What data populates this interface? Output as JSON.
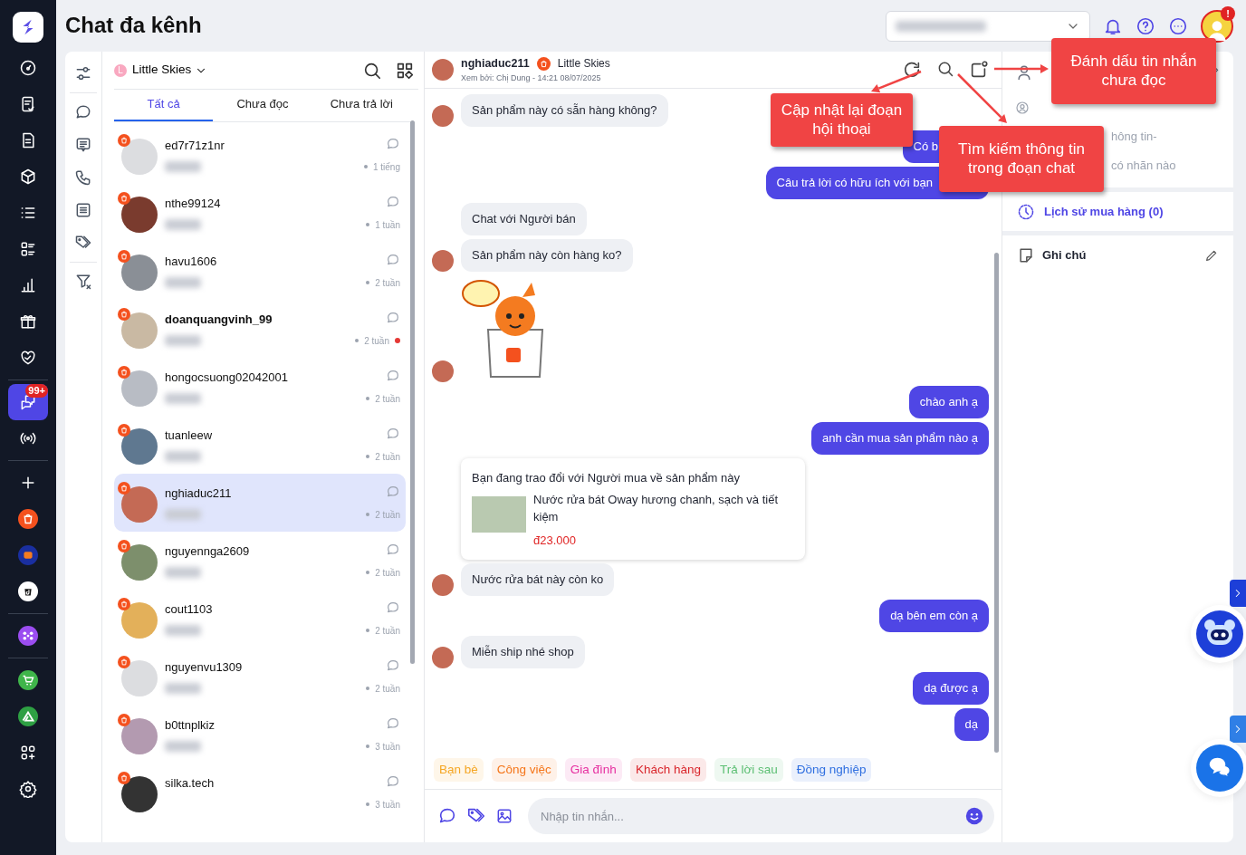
{
  "header": {
    "title": "Chat đa kênh",
    "alert_badge": "!"
  },
  "sidebar": {
    "nav_items": [
      {
        "selected": false
      },
      {
        "selected": false
      },
      {
        "selected": false
      },
      {
        "selected": false
      },
      {
        "selected": false
      },
      {
        "selected": false
      },
      {
        "selected": false
      },
      {
        "selected": false
      },
      {
        "selected": false
      },
      {
        "selected": true,
        "badge": "99+"
      },
      {
        "selected": false
      },
      {
        "selected": false
      },
      {
        "selected": false
      },
      {
        "selected": false
      },
      {
        "selected": false
      },
      {
        "selected": false
      },
      {
        "selected": false
      },
      {
        "selected": false
      },
      {
        "selected": false
      },
      {
        "selected": false
      }
    ]
  },
  "conversation_list": {
    "shop": {
      "initial": "L",
      "name": "Little Skies"
    },
    "tabs": [
      {
        "label": "Tất cả",
        "selected": true
      },
      {
        "label": "Chưa đọc",
        "selected": false
      },
      {
        "label": "Chưa trả lời",
        "selected": false
      }
    ],
    "conversations": [
      {
        "name": "ed7r71z1nr",
        "time": "1 tiếng",
        "unread": false,
        "selected": false,
        "preview_blurred": true
      },
      {
        "name": "nthe99124",
        "time": "1 tuần",
        "unread": false,
        "selected": false,
        "preview_blurred": true
      },
      {
        "name": "havu1606",
        "time": "2 tuần",
        "unread": false,
        "selected": false,
        "preview_blurred": true
      },
      {
        "name": "doanquangvinh_99",
        "time": "2 tuần",
        "unread": true,
        "selected": false,
        "preview_blurred": true
      },
      {
        "name": "hongocsuong02042001",
        "time": "2 tuần",
        "unread": false,
        "selected": false,
        "preview_blurred": true
      },
      {
        "name": "tuanleew",
        "time": "2 tuần",
        "unread": false,
        "selected": false,
        "preview_blurred": true
      },
      {
        "name": "nghiaduc211",
        "time": "2 tuần",
        "unread": false,
        "selected": true,
        "preview_blurred": true
      },
      {
        "name": "nguyennga2609",
        "time": "2 tuần",
        "unread": false,
        "selected": false,
        "preview_blurred": true
      },
      {
        "name": "cout1103",
        "time": "2 tuần",
        "unread": false,
        "selected": false,
        "preview_blurred": true
      },
      {
        "name": "nguyenvu1309",
        "time": "2 tuần",
        "unread": false,
        "selected": false,
        "preview_blurred": true
      },
      {
        "name": "b0ttnplkiz",
        "time": "3 tuần",
        "unread": false,
        "selected": false,
        "preview_blurred": true
      },
      {
        "name": "silka.tech",
        "time": "3 tuần",
        "unread": false,
        "selected": false,
        "preview_blurred": false
      }
    ]
  },
  "chat": {
    "name": "nghiaduc211",
    "shop": "Little Skies",
    "seen_by": "Xem bởi: Chị Dung - 14:21 08/07/2025",
    "messages": [
      {
        "kind": "in",
        "avatar": true,
        "text": "Sản phẩm này có sẵn hàng không?"
      },
      {
        "kind": "out",
        "text": "Có b"
      },
      {
        "kind": "out",
        "text": "Câu trả lời có hữu ích với bạn"
      },
      {
        "kind": "in",
        "avatar": false,
        "text": "Chat với Người bán"
      },
      {
        "kind": "in",
        "avatar": true,
        "text": "Sản phẩm này còn hàng ko?"
      },
      {
        "kind": "sticker",
        "avatar": true
      },
      {
        "kind": "out",
        "text": "chào anh ạ"
      },
      {
        "kind": "out",
        "text": "anh cần mua sản phẩm nào ạ"
      },
      {
        "kind": "product",
        "title": "Bạn đang trao đổi với Người mua về sản phẩm này",
        "name": "Nước rửa bát Oway hương chanh, sạch và tiết kiệm",
        "price": "đ23.000"
      },
      {
        "kind": "in",
        "avatar": true,
        "text": "Nước rửa bát này còn ko"
      },
      {
        "kind": "out",
        "text": "dạ bên em còn ạ"
      },
      {
        "kind": "in",
        "avatar": true,
        "text": "Miễn ship nhé shop"
      },
      {
        "kind": "out",
        "text": "dạ được ạ"
      },
      {
        "kind": "out",
        "text": "dạ"
      }
    ],
    "tags": [
      {
        "label": "Bạn bè",
        "color": "#f5a623"
      },
      {
        "label": "Công việc",
        "color": "#f5761a"
      },
      {
        "label": "Gia đình",
        "color": "#e62ea0"
      },
      {
        "label": "Khách hàng",
        "color": "#d9262c"
      },
      {
        "label": "Trả lời sau",
        "color": "#5cbf73"
      },
      {
        "label": "Đồng nghiệp",
        "color": "#2f6fe0"
      }
    ],
    "composer": {
      "placeholder": "Nhập tin nhắn..."
    }
  },
  "customer_panel": {
    "fragments": [
      "hông tin-",
      "có nhãn nào"
    ],
    "purchase_history": "Lịch sử mua hàng (0)",
    "notes_title": "Ghi chú"
  },
  "callouts": [
    {
      "text": "Cập nhật lại đoạn hội thoại"
    },
    {
      "text": "Tìm kiếm thông tin trong đoạn chat"
    },
    {
      "text": "Đánh dấu tin nhắn chưa đọc"
    }
  ]
}
